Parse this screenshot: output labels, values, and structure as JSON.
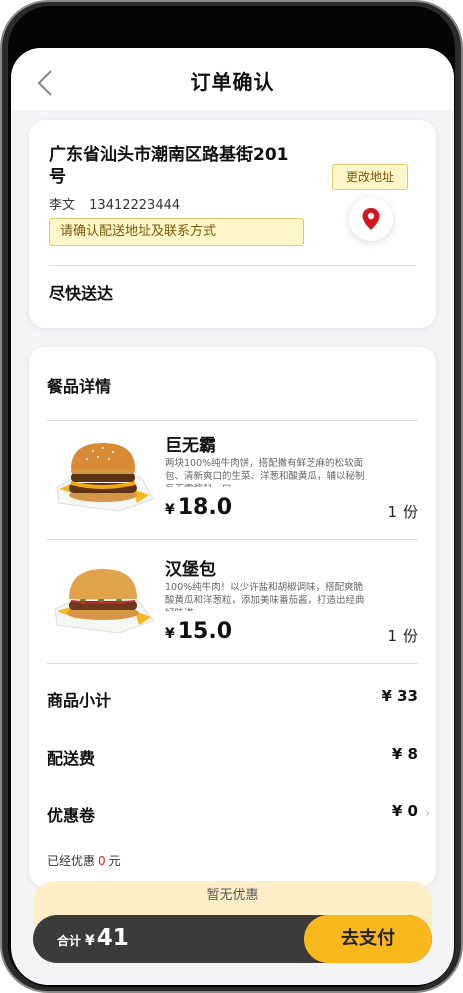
{
  "header": {
    "title": "订单确认",
    "back_icon": "chevron-left-icon"
  },
  "address": {
    "text": "广东省汕头市潮南区路基街201号",
    "name": "李文",
    "phone": "13412223444",
    "confirm_tip": "请确认配送地址及联系方式",
    "change_label": "更改地址",
    "pin_icon": "location-pin-icon",
    "pin_color": "#d4161c",
    "delivery_time": "尽快送达"
  },
  "items": {
    "section_title": "餐品详情",
    "products": [
      {
        "name": "巨无霸",
        "description": "两块100%纯牛肉饼，搭配撒有鲜芝麻的松软面包、清新爽口的生菜、洋葱和酸黄瓜，辅以秘制巨无霸酱料，口",
        "currency": "¥",
        "price": "18.0",
        "qty": "1",
        "unit": "份"
      },
      {
        "name": "汉堡包",
        "description": "100%纯牛肉！以少许盐和胡椒调味，搭配爽脆酸黄瓜和洋葱粒，添加美味番茄酱，打造出经典好味道",
        "currency": "¥",
        "price": "15.0",
        "qty": "1",
        "unit": "份"
      }
    ]
  },
  "summary": {
    "subtotal_label": "商品小计",
    "subtotal_value": "¥ 33",
    "delivery_label": "配送费",
    "delivery_value": "¥ 8",
    "coupon_label": "优惠卷",
    "coupon_value": "¥ 0",
    "saved_prefix": "已经优惠",
    "saved_amount": "0",
    "saved_suffix": "元"
  },
  "footer": {
    "promo": "暂无优惠",
    "total_label": "合计",
    "currency": "¥",
    "total_value": "41",
    "pay_label": "去支付",
    "accent_color": "#f9b81c"
  }
}
